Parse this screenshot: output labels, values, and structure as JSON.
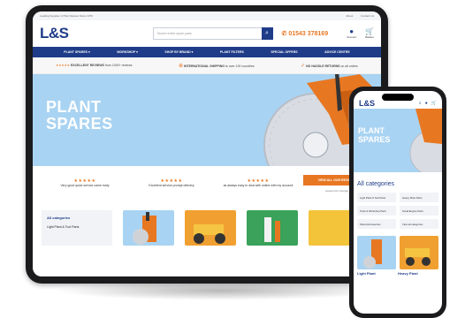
{
  "brand": {
    "name": "L&S",
    "primary": "#1f3c88",
    "accent": "#e87722",
    "hero_bg": "#a9d3f2"
  },
  "topbar": {
    "left": "Leading Supplier of Plant Spares Since 1979",
    "links": [
      "About",
      "Contact Us"
    ]
  },
  "header": {
    "search_placeholder": "Search entire spare parts",
    "phone": "01543 378169",
    "account_label": "Account",
    "basket_label": "Basket"
  },
  "nav": [
    "PLANT SPARES",
    "WORKSHOP",
    "SHOP BY BRAND",
    "PLANT FILTERS",
    "SPECIAL OFFERS",
    "ADVICE CENTRE"
  ],
  "trust": [
    {
      "icon": "stars",
      "bold": "EXCELLENT REVIEWS",
      "text": "from 1000+ reviews"
    },
    {
      "icon": "globe-icon",
      "bold": "INTERNATIONAL SHIPPING",
      "text": "to over 100 countries"
    },
    {
      "icon": "check-icon",
      "bold": "NO HASSLE RETURNS",
      "text": "on all orders"
    }
  ],
  "hero": {
    "title_line1": "PLANT",
    "title_line2": "SPARES"
  },
  "reviews": [
    {
      "stars": "★★★★★",
      "text": "Very good quick service came early"
    },
    {
      "stars": "★★★★★",
      "text": "Excellent service prompt delivery"
    },
    {
      "stars": "★★★★★",
      "text": "as always easy to deal with online with my account"
    }
  ],
  "reviews_button": "VIEW ALL OUR REVIEWS",
  "powered_by": "powered by Google",
  "categories": {
    "heading": "All categories",
    "first_item": "Light Plant & Tool Parts"
  },
  "mobile": {
    "hero_line1": "PLANT",
    "hero_line2": "SPARES",
    "categories_heading": "All categories",
    "category_items": [
      "Light Plant & Tool Parts",
      "Heavy Plant Parts",
      "Tools & Workshop Parts",
      "Small Engine Parts",
      "Filters/Accessories",
      "View all categories"
    ],
    "product_labels": [
      "Light Plant",
      "Heavy Plant"
    ]
  }
}
